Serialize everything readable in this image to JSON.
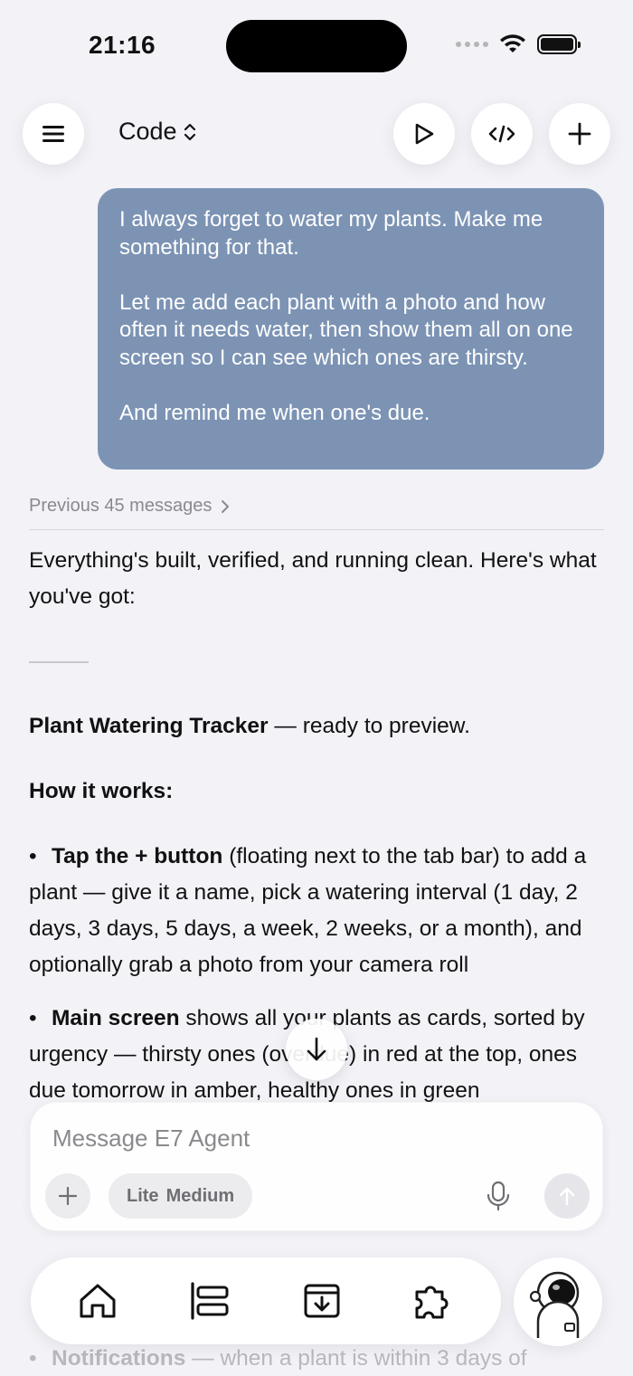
{
  "status_bar": {
    "time": "21:16"
  },
  "toolbar": {
    "mode_label": "Code",
    "menu_icon": "hamburger-icon",
    "run_icon": "play-icon",
    "code_icon": "code-icon",
    "new_icon": "plus-icon"
  },
  "user_message": {
    "paragraphs": [
      "I always forget to water my plants. Make me something for that.",
      "Let me add each plant with a photo and how often it needs water, then show them all on one screen so I can see which ones are thirsty.",
      "And remind me when one's due."
    ]
  },
  "previous_messages_label": "Previous 45 messages",
  "reply": {
    "intro": "Everything's built, verified, and running clean. Here's what you've got:",
    "title_bold": "Plant Watering Tracker",
    "title_rest": " — ready to preview.",
    "how_heading": "How it works:",
    "bullet1_bold": "Tap the + button",
    "bullet1_rest": " (floating next to the tab bar) to add a plant — give it a name, pick a watering interval (1 day, 2 days, 3 days, 5 days, a week, 2 weeks, or a month), and optionally grab a photo from your camera roll",
    "bullet2_bold": "Main screen",
    "bullet2_rest": " shows all your plants as cards, sorted by urgency — thirsty ones (overdue) in red at the top, ones due tomorrow in amber, healthy ones in green",
    "bullet3_bold": "Notifications",
    "bullet3_rest": " — when a plant is within 3 days of"
  },
  "composer": {
    "placeholder": "Message E7 Agent",
    "model_label_1": "Lite",
    "model_label_2": "Medium"
  },
  "tabbar": {
    "tabs": [
      "home-icon",
      "align-left-icon",
      "archive-download-icon",
      "puzzle-icon"
    ],
    "avatar": "astronaut-avatar"
  }
}
